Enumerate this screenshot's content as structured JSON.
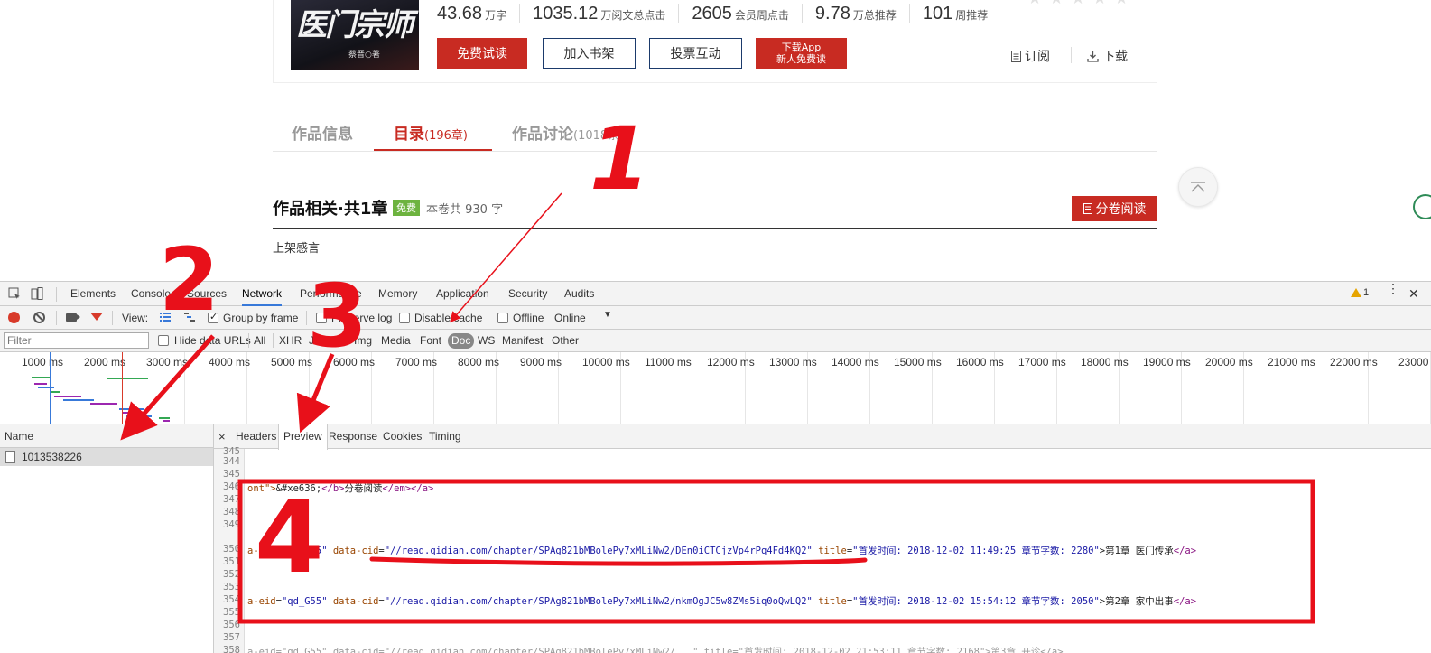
{
  "book": {
    "cover_title": "医门宗师",
    "cover_author": "蔡晋○著",
    "stats": [
      {
        "num": "43.68",
        "unit": "万字"
      },
      {
        "num": "1035.12",
        "unit": "万阅文总点击"
      },
      {
        "num": "2605",
        "unit": "会员周点击"
      },
      {
        "num": "9.78",
        "unit": "万总推荐"
      },
      {
        "num": "101",
        "unit": "周推荐"
      }
    ],
    "buttons": {
      "free_read": "免费试读",
      "add_shelf": "加入书架",
      "vote": "投票互动",
      "app_line1": "下载App",
      "app_line2": "新人免费读"
    },
    "subscribe": "订阅",
    "download": "下载"
  },
  "tabs": {
    "info": "作品信息",
    "catalog": "目录",
    "catalog_count": "(196章)",
    "discuss": "作品讨论",
    "discuss_count": "(1018条)"
  },
  "volume": {
    "title": "作品相关·共1章",
    "free_badge": "免费",
    "word_count": "本卷共 930 字",
    "read_button": "分卷阅读",
    "chapter": "上架感言"
  },
  "devtools": {
    "tabs": [
      "Elements",
      "Console",
      "Sources",
      "Network",
      "Performance",
      "Memory",
      "Application",
      "Security",
      "Audits"
    ],
    "active_tab": "Network",
    "warning_count": "1",
    "toolbar": {
      "view": "View:",
      "group_by_frame": "Group by frame",
      "preserve_log": "Preserve log",
      "disable_cache": "Disable cache",
      "offline": "Offline",
      "throttle": "Online"
    },
    "filter": {
      "placeholder": "Filter",
      "hide_data_urls": "Hide data URLs",
      "types": [
        "All",
        "XHR",
        "JS",
        "CSS",
        "Img",
        "Media",
        "Font",
        "Doc",
        "WS",
        "Manifest",
        "Other"
      ],
      "active_type": "Doc"
    },
    "timeline_ticks": [
      "1000 ms",
      "2000 ms",
      "3000 ms",
      "4000 ms",
      "5000 ms",
      "6000 ms",
      "7000 ms",
      "8000 ms",
      "9000 ms",
      "10000 ms",
      "11000 ms",
      "12000 ms",
      "13000 ms",
      "14000 ms",
      "15000 ms",
      "16000 ms",
      "17000 ms",
      "18000 ms",
      "19000 ms",
      "20000 ms",
      "21000 ms",
      "22000 ms",
      "23000"
    ],
    "name_header": "Name",
    "request_name": "1013538226",
    "detail_tabs": [
      "Headers",
      "Preview",
      "Response",
      "Cookies",
      "Timing"
    ],
    "active_detail_tab": "Preview",
    "line_numbers": [
      "345",
      "344",
      "345",
      "346",
      "347",
      "348",
      "349",
      "350",
      "351",
      "352",
      "353",
      "354",
      "355",
      "356",
      "357",
      "358"
    ],
    "code": {
      "l1_a": "ont\">",
      "l1_b": "&#xe636;",
      "l1_c": "</b>",
      "l1_d": "分卷阅读",
      "l1_e": "</em></a>",
      "eid_attr": "a-eid",
      "eid_val": "\"qd_G55\"",
      "cid_attr": "data-cid",
      "cid1": "\"//read.qidian.com/chapter/SPAg821bMBolePy7xMLiNw2/DEn0iCTCjzVp4rPq4Fd4KQ2\"",
      "title_attr": "title",
      "title1": "\"首发时间: 2018-12-02 11:49:25 章节字数: 2280\"",
      "text1": ">第1章 医门传承",
      "close_a": "</a>",
      "cid2": "\"//read.qidian.com/chapter/SPAg821bMBolePy7xMLiNw2/nkmOgJC5w8ZMs5iq0oQwLQ2\"",
      "title2": "\"首发时间: 2018-12-02 15:54:12 章节字数: 2050\"",
      "text2": ">第2章 家中出事",
      "l3": "a-eid=\"qd_G55\" data-cid=\"//read.qidian.com/chapter/SPAg821bMBolePy7xMLiNw2/...\" title=\"首发时间: 2018-12-02 21:53:11 章节字数: 2168\">第3章 开诊</a>"
    }
  },
  "annotations": [
    "1",
    "2",
    "3",
    "4"
  ],
  "colors": {
    "accent_red": "#c82b22",
    "annotation_red": "#e8101a",
    "devtools_blue": "#3879d9"
  }
}
